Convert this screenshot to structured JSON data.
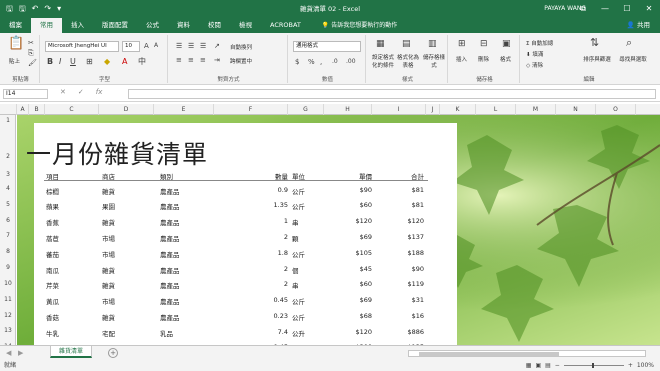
{
  "window": {
    "title": "雜貨清單 02 - Excel",
    "user": "PAYAYA WANG",
    "controls": [
      "⧉",
      "—",
      "☐",
      "✕"
    ]
  },
  "ribbon_tabs": [
    "檔案",
    "常用",
    "插入",
    "版面配置",
    "公式",
    "資料",
    "校閱",
    "檢視",
    "ACROBAT"
  ],
  "tell_me": "告訴我您想要執行的動作",
  "share": "共用",
  "ribbon": {
    "paste": "貼上",
    "font_name": "Microsoft JhengHei UI",
    "font_size": "10",
    "wrap": "自動換列",
    "merge": "跨欄置中",
    "number_format": "通用格式",
    "cond_format": "設定格式化的條件",
    "format_table": "格式化為表格",
    "cell_styles": "儲存格樣式",
    "insert": "插入",
    "delete": "刪除",
    "format": "格式",
    "autosum": "自動加總",
    "fill": "填滿",
    "clear": "清除",
    "sort": "排序與篩選",
    "find": "尋找與選取",
    "groups": [
      "剪貼簿",
      "字型",
      "對齊方式",
      "數值",
      "樣式",
      "儲存格",
      "編輯"
    ]
  },
  "formula_bar": {
    "name_box": "I14",
    "fx": "fx"
  },
  "columns": [
    "A",
    "B",
    "C",
    "D",
    "E",
    "F",
    "G",
    "H",
    "I",
    "J",
    "K",
    "L",
    "M",
    "N",
    "O"
  ],
  "rows": [
    "1",
    "2",
    "3",
    "4",
    "5",
    "6",
    "7",
    "8",
    "9",
    "10",
    "11",
    "12",
    "13",
    "14"
  ],
  "sheet": {
    "title": "一月份雜貨清單",
    "headers": {
      "item": "項目",
      "store": "商店",
      "category": "類別",
      "qty": "數量",
      "unit": "單位",
      "price": "單價",
      "total": "合計"
    },
    "data": [
      {
        "item": "棕櫚",
        "store": "雜貨",
        "category": "農產品",
        "qty": "0.9",
        "unit": "公斤",
        "price": "$90",
        "total": "$81"
      },
      {
        "item": "蘋果",
        "store": "果園",
        "category": "農產品",
        "qty": "1.35",
        "unit": "公斤",
        "price": "$60",
        "total": "$81"
      },
      {
        "item": "香蕉",
        "store": "雜貨",
        "category": "農產品",
        "qty": "1",
        "unit": "串",
        "price": "$120",
        "total": "$120"
      },
      {
        "item": "萵苣",
        "store": "市場",
        "category": "農產品",
        "qty": "2",
        "unit": "顆",
        "price": "$69",
        "total": "$137"
      },
      {
        "item": "蕃茄",
        "store": "市場",
        "category": "農產品",
        "qty": "1.8",
        "unit": "公斤",
        "price": "$105",
        "total": "$188"
      },
      {
        "item": "南瓜",
        "store": "雜貨",
        "category": "農產品",
        "qty": "2",
        "unit": "個",
        "price": "$45",
        "total": "$90"
      },
      {
        "item": "芹菜",
        "store": "雜貨",
        "category": "農產品",
        "qty": "2",
        "unit": "串",
        "price": "$60",
        "total": "$119"
      },
      {
        "item": "黃瓜",
        "store": "市場",
        "category": "農產品",
        "qty": "0.45",
        "unit": "公斤",
        "price": "$69",
        "total": "$31"
      },
      {
        "item": "香菇",
        "store": "雜貨",
        "category": "農產品",
        "qty": "0.23",
        "unit": "公斤",
        "price": "$68",
        "total": "$16"
      },
      {
        "item": "牛乳",
        "store": "宅配",
        "category": "乳品",
        "qty": "7.4",
        "unit": "公升",
        "price": "$120",
        "total": "$886"
      },
      {
        "item": "起司",
        "store": "宅配",
        "category": "乳品",
        "qty": "0.45",
        "unit": "公斤",
        "price": "$300",
        "total": "$135"
      }
    ]
  },
  "sheet_tab": "雜貨清單",
  "status": "就緒",
  "zoom": "100%"
}
